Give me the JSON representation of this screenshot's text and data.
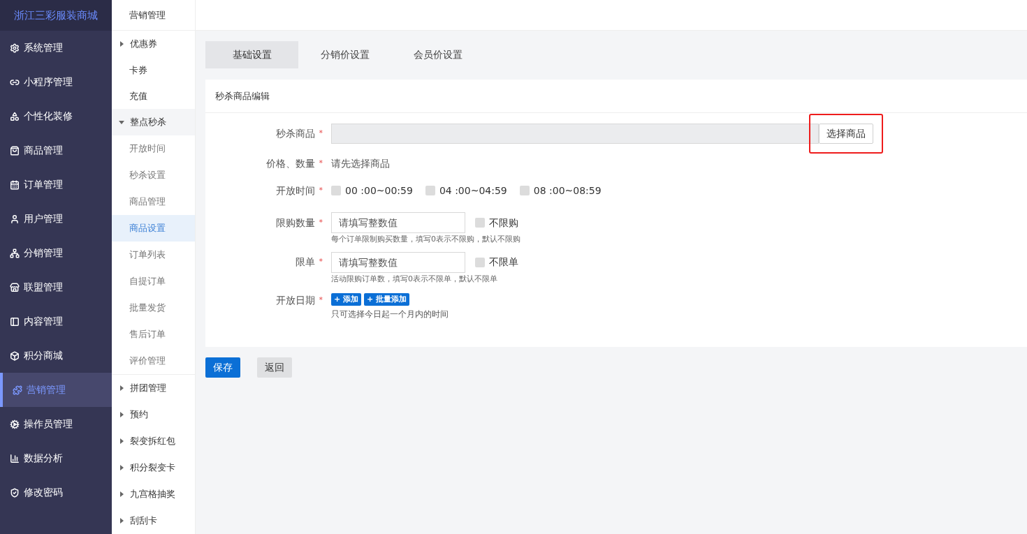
{
  "brand": "浙江三彩服装商城",
  "nav": [
    {
      "label": "系统管理",
      "selected": false
    },
    {
      "label": "小程序管理",
      "selected": false
    },
    {
      "label": "个性化装修",
      "selected": false
    },
    {
      "label": "商品管理",
      "selected": false
    },
    {
      "label": "订单管理",
      "selected": false
    },
    {
      "label": "用户管理",
      "selected": false
    },
    {
      "label": "分销管理",
      "selected": false
    },
    {
      "label": "联盟管理",
      "selected": false
    },
    {
      "label": "内容管理",
      "selected": false
    },
    {
      "label": "积分商城",
      "selected": false
    },
    {
      "label": "营销管理",
      "selected": true
    },
    {
      "label": "操作员管理",
      "selected": false
    },
    {
      "label": "数据分析",
      "selected": false
    },
    {
      "label": "修改密码",
      "selected": false
    }
  ],
  "submenu": {
    "title": "营销管理",
    "items": [
      {
        "kind": "group",
        "label": "优惠券",
        "expanded": false
      },
      {
        "kind": "link",
        "label": "卡券",
        "selected": false
      },
      {
        "kind": "link",
        "label": "充值",
        "selected": false
      },
      {
        "kind": "group",
        "label": "整点秒杀",
        "expanded": true,
        "children": [
          {
            "label": "开放时间",
            "selected": false
          },
          {
            "label": "秒杀设置",
            "selected": false
          },
          {
            "label": "商品管理",
            "selected": false
          },
          {
            "label": "商品设置",
            "selected": true
          },
          {
            "label": "订单列表",
            "selected": false
          },
          {
            "label": "自提订单",
            "selected": false
          },
          {
            "label": "批量发货",
            "selected": false
          },
          {
            "label": "售后订单",
            "selected": false
          },
          {
            "label": "评价管理",
            "selected": false
          }
        ]
      },
      {
        "kind": "group",
        "label": "拼团管理",
        "expanded": false
      },
      {
        "kind": "group",
        "label": "预约",
        "expanded": false
      },
      {
        "kind": "group",
        "label": "裂变拆红包",
        "expanded": false
      },
      {
        "kind": "group",
        "label": "积分裂变卡",
        "expanded": false
      },
      {
        "kind": "group",
        "label": "九宫格抽奖",
        "expanded": false
      },
      {
        "kind": "group",
        "label": "刮刮卡",
        "expanded": false
      }
    ]
  },
  "tabs": [
    {
      "label": "基础设置",
      "selected": true
    },
    {
      "label": "分销价设置",
      "selected": false
    },
    {
      "label": "会员价设置",
      "selected": false
    }
  ],
  "form": {
    "title": "秒杀商品编辑",
    "required_mark": "*",
    "product": {
      "label": "秒杀商品",
      "button": "选择商品",
      "highlighted": true
    },
    "price": {
      "label": "价格、数量",
      "text": "请先选择商品"
    },
    "open_time": {
      "label": "开放时间",
      "options": [
        {
          "label": "00 :00~00:59",
          "checked": false
        },
        {
          "label": "04 :00~04:59",
          "checked": false
        },
        {
          "label": "08 :00~08:59",
          "checked": false
        }
      ]
    },
    "limit_qty": {
      "label": "限购数量",
      "placeholder": "请填写整数值",
      "checkbox": {
        "label": "不限购",
        "checked": false
      },
      "hint": "每个订单限制购买数量，填写0表示不限购，默认不限购"
    },
    "limit_orders": {
      "label": "限单",
      "placeholder": "请填写整数值",
      "checkbox": {
        "label": "不限单",
        "checked": false
      },
      "hint": "活动限购订单数，填写0表示不限单，默认不限单"
    },
    "open_date": {
      "label": "开放日期",
      "buttons": [
        "+ 添加",
        "+ 批量添加"
      ],
      "hint": "只可选择今日起一个月内的时间"
    }
  },
  "actions": {
    "save": "保存",
    "back": "返回"
  }
}
